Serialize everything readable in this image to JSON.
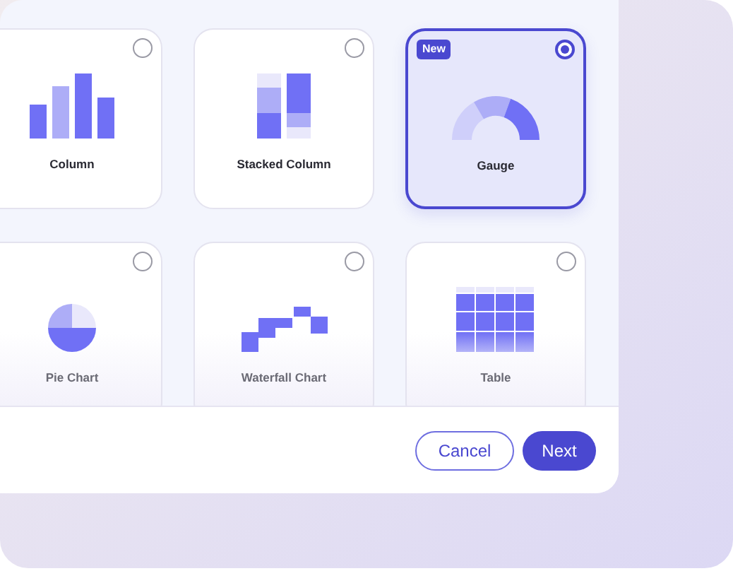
{
  "chart_types": [
    {
      "kind": "column",
      "label": "Column",
      "selected": false
    },
    {
      "kind": "stacked_column",
      "label": "Stacked Column",
      "selected": false
    },
    {
      "kind": "gauge",
      "label": "Gauge",
      "selected": true,
      "badge": "New"
    },
    {
      "kind": "pie",
      "label": "Pie Chart",
      "selected": false
    },
    {
      "kind": "waterfall",
      "label": "Waterfall Chart",
      "selected": false
    },
    {
      "kind": "table",
      "label": "Table",
      "selected": false
    }
  ],
  "buttons": [
    {
      "kind": "secondary",
      "label": "Cancel"
    },
    {
      "kind": "primary",
      "label": "Next"
    }
  ]
}
